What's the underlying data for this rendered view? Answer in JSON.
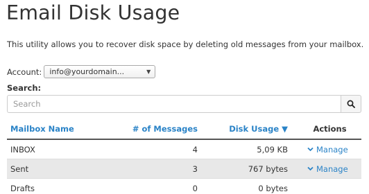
{
  "page": {
    "title": "Email Disk Usage",
    "description": "This utility allows you to recover disk space by deleting old messages from your mailbox."
  },
  "account": {
    "label": "Account:",
    "selected": "info@yourdomain..."
  },
  "search": {
    "label": "Search:",
    "placeholder": "Search",
    "icon": "search-icon"
  },
  "table": {
    "headers": {
      "mailbox": "Mailbox Name",
      "messages": "# of Messages",
      "disk_usage": "Disk Usage ▼",
      "actions": "Actions"
    },
    "rows": [
      {
        "mailbox": "INBOX",
        "messages": "4",
        "disk_usage": "5,09 KB",
        "action": "Manage"
      },
      {
        "mailbox": "Sent",
        "messages": "3",
        "disk_usage": "767 bytes",
        "action": "Manage"
      },
      {
        "mailbox": "Drafts",
        "messages": "0",
        "disk_usage": "0 bytes",
        "action": ""
      }
    ]
  },
  "colors": {
    "link": "#2a83c7",
    "text": "#333333",
    "row_alt": "#e8e8e8"
  }
}
